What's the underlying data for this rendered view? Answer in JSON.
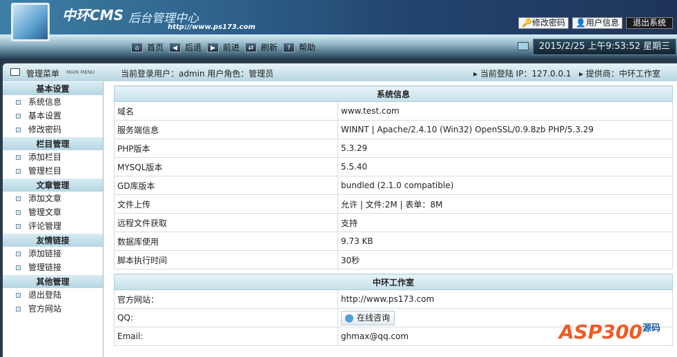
{
  "header": {
    "brand": "中环CMS",
    "subtitle": "后台管理中心",
    "url": "http://www.ps173.com",
    "buttons": {
      "change_password": "修改密码",
      "user_info": "用户信息",
      "logout": "退出系统"
    }
  },
  "nav": {
    "items": [
      {
        "label": "首页",
        "icon": "home-icon"
      },
      {
        "label": "后退",
        "icon": "back-icon"
      },
      {
        "label": "前进",
        "icon": "forward-icon"
      },
      {
        "label": "刷新",
        "icon": "refresh-icon"
      },
      {
        "label": "帮助",
        "icon": "help-icon"
      }
    ],
    "clock": "2015/2/25 上午9:53:52 星期三"
  },
  "menubar": {
    "title": "管理菜单",
    "subtitle": "MAIN MENU",
    "user": "当前登录用户：admin  用户角色：管理员",
    "ip": "▸ 当前登陆 IP：127.0.0.1",
    "provider": "▸ 提供商：中环工作室"
  },
  "sidebar": [
    {
      "title": "基本设置",
      "items": [
        "系统信息",
        "基本设置",
        "修改密码"
      ]
    },
    {
      "title": "栏目管理",
      "items": [
        "添加栏目",
        "管理栏目"
      ]
    },
    {
      "title": "文章管理",
      "items": [
        "添加文章",
        "管理文章",
        "评论管理"
      ]
    },
    {
      "title": "友情链接",
      "items": [
        "添加链接",
        "管理链接"
      ]
    },
    {
      "title": "其他管理",
      "items": [
        "退出登陆",
        "官方网站"
      ]
    }
  ],
  "sysinfo": {
    "title": "系统信息",
    "rows": [
      [
        "域名",
        "www.test.com"
      ],
      [
        "服务端信息",
        "WINNT | Apache/2.4.10 (Win32) OpenSSL/0.9.8zb PHP/5.3.29"
      ],
      [
        "PHP版本",
        "5.3.29"
      ],
      [
        "MYSQL版本",
        "5.5.40"
      ],
      [
        "GD库版本",
        "bundled (2.1.0 compatible)"
      ],
      [
        "文件上传",
        "允许 | 文件:2M | 表单：8M"
      ],
      [
        "远程文件获取",
        "支持"
      ],
      [
        "数据库使用",
        "9.73 KB"
      ],
      [
        "脚本执行时间",
        "30秒"
      ]
    ]
  },
  "studio": {
    "title": "中环工作室",
    "site_label": "官方网站：",
    "site": "http://www.ps173.com",
    "qq_label": "QQ:",
    "qq_button": "在线咨询",
    "email_label": "Email:",
    "email": "ghmax@qq.com"
  },
  "watermark": {
    "text": "ASP300",
    "suffix": "源码"
  }
}
